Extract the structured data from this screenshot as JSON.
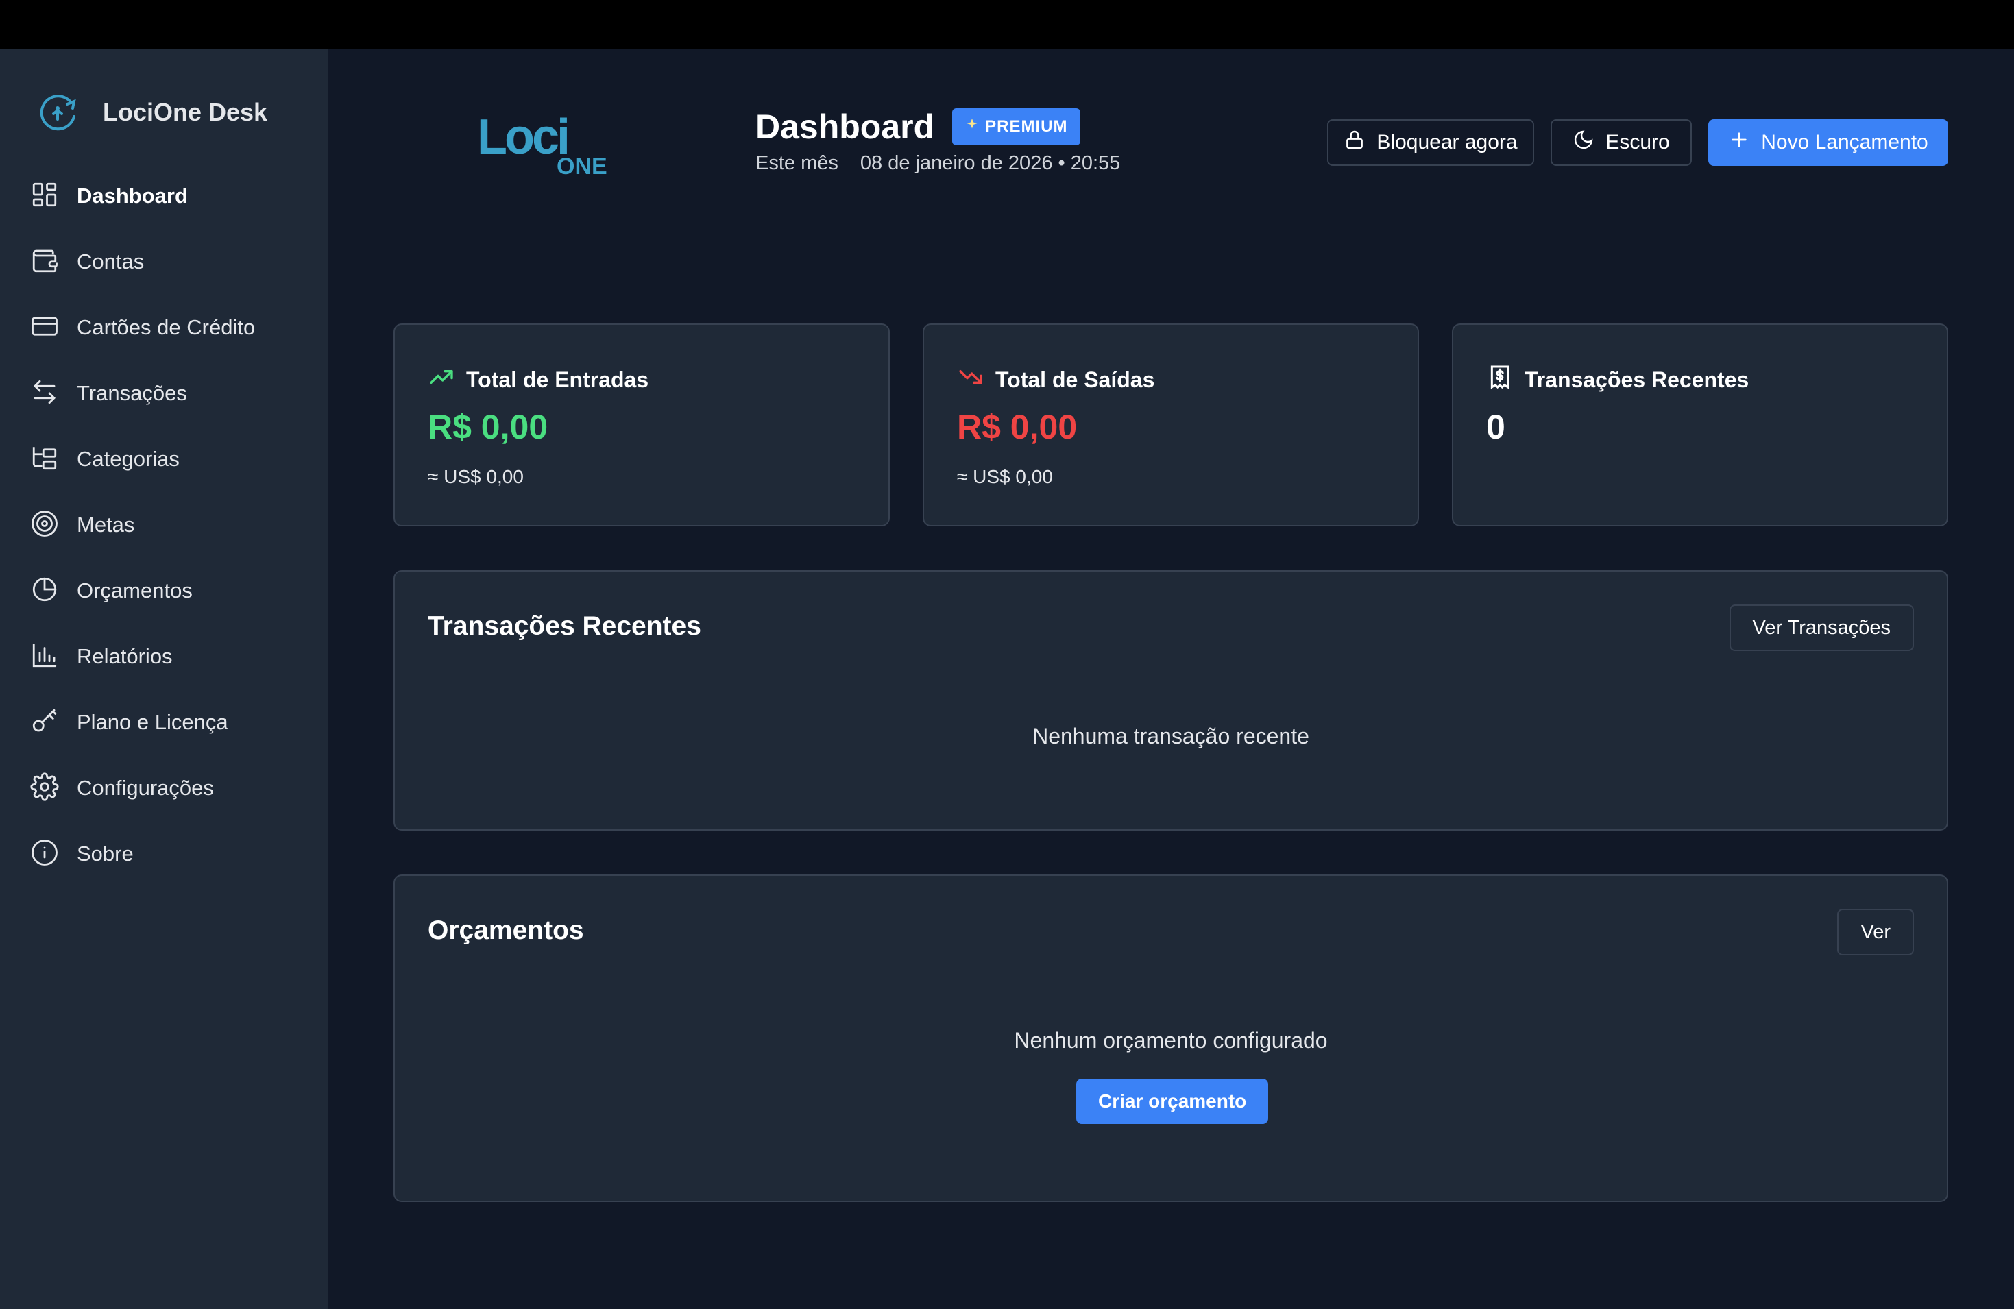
{
  "app": {
    "name": "LociOne Desk"
  },
  "logo": {
    "text_top": "Loci",
    "text_bottom": "ONE"
  },
  "sidebar": {
    "items": [
      {
        "label": "Dashboard",
        "icon": "dashboard-icon",
        "active": true
      },
      {
        "label": "Contas",
        "icon": "wallet-icon"
      },
      {
        "label": "Cartões de Crédito",
        "icon": "credit-card-icon"
      },
      {
        "label": "Transações",
        "icon": "transfer-arrows-icon"
      },
      {
        "label": "Categorias",
        "icon": "categories-tree-icon"
      },
      {
        "label": "Metas",
        "icon": "target-icon"
      },
      {
        "label": "Orçamentos",
        "icon": "pie-chart-icon"
      },
      {
        "label": "Relatórios",
        "icon": "bar-chart-icon"
      },
      {
        "label": "Plano e Licença",
        "icon": "key-icon"
      },
      {
        "label": "Configurações",
        "icon": "gear-icon"
      },
      {
        "label": "Sobre",
        "icon": "info-icon"
      }
    ]
  },
  "header": {
    "title": "Dashboard",
    "badge": "PREMIUM",
    "period": "Este mês",
    "datetime": "08 de janeiro de 2026 • 20:55",
    "lock_button": "Bloquear agora",
    "theme_button": "Escuro",
    "new_button": "Novo Lançamento"
  },
  "stats": {
    "income": {
      "title": "Total de Entradas",
      "value": "R$ 0,00",
      "sub": "≈ US$ 0,00"
    },
    "expense": {
      "title": "Total de Saídas",
      "value": "R$ 0,00",
      "sub": "≈ US$ 0,00"
    },
    "recent": {
      "title": "Transações Recentes",
      "value": "0"
    }
  },
  "recent_section": {
    "title": "Transações Recentes",
    "button": "Ver Transações",
    "empty": "Nenhuma transação recente"
  },
  "budgets_section": {
    "title": "Orçamentos",
    "button": "Ver",
    "empty": "Nenhum orçamento configurado",
    "create_button": "Criar orçamento"
  },
  "colors": {
    "accent": "#3b82f6",
    "income": "#4ade80",
    "expense": "#ef4444",
    "logo": "#3aa0c8"
  }
}
